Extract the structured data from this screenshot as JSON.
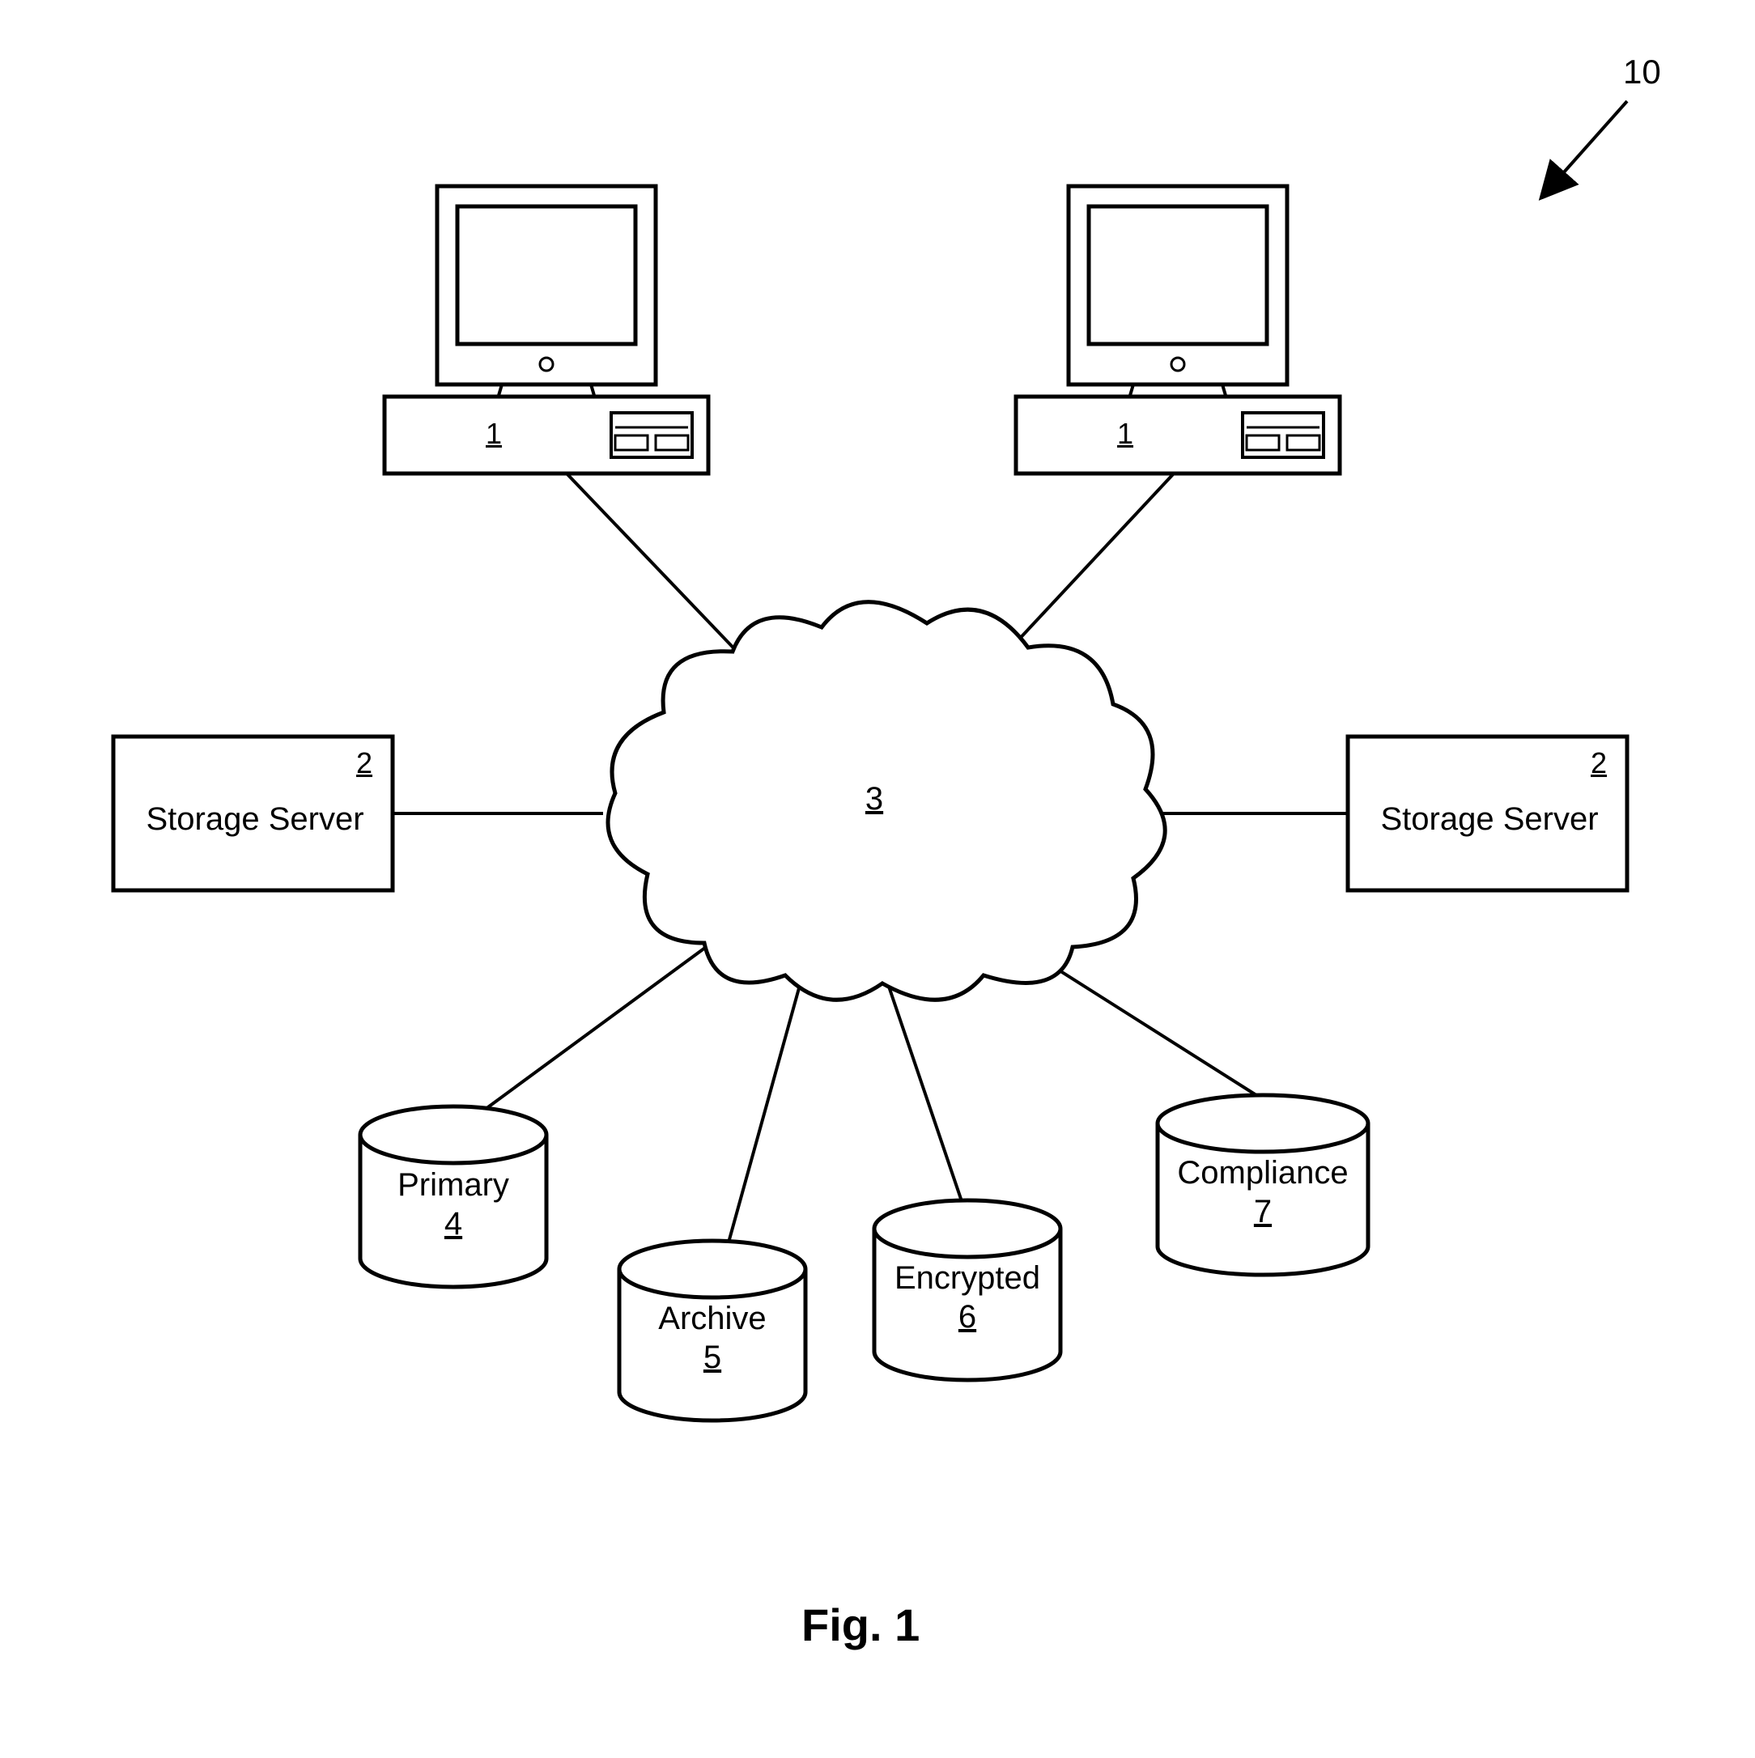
{
  "figure": {
    "overallRef": "10",
    "caption": "Fig. 1"
  },
  "nodes": {
    "pcLeft": {
      "ref": "1"
    },
    "pcRight": {
      "ref": "1"
    },
    "serverLeft": {
      "label": "Storage Server",
      "ref": "2"
    },
    "serverRight": {
      "label": "Storage Server",
      "ref": "2"
    },
    "cloud": {
      "ref": "3"
    },
    "primary": {
      "label": "Primary",
      "ref": "4"
    },
    "archive": {
      "label": "Archive",
      "ref": "5"
    },
    "encrypted": {
      "label": "Encrypted",
      "ref": "6"
    },
    "compliance": {
      "label": "Compliance",
      "ref": "7"
    }
  },
  "edges": [
    [
      "pcLeft",
      "cloud"
    ],
    [
      "pcRight",
      "cloud"
    ],
    [
      "serverLeft",
      "cloud"
    ],
    [
      "serverRight",
      "cloud"
    ],
    [
      "cloud",
      "primary"
    ],
    [
      "cloud",
      "archive"
    ],
    [
      "cloud",
      "encrypted"
    ],
    [
      "cloud",
      "compliance"
    ]
  ]
}
